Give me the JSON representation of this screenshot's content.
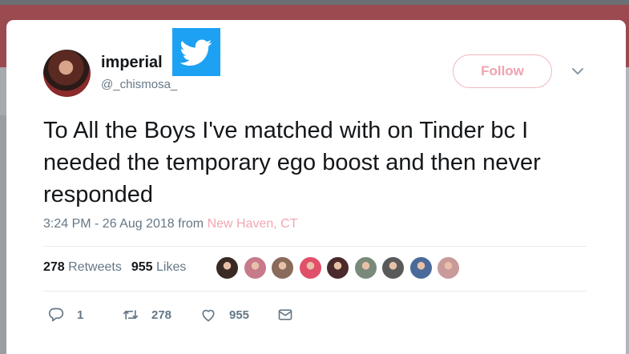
{
  "tweet": {
    "author": {
      "name": "imperial",
      "handle": "@_chismosa_"
    },
    "follow_label": "Follow",
    "text": "To All the Boys I've matched with on Tinder bc I needed the temporary ego boost and then never responded",
    "timestamp": "3:24 PM - 26 Aug 2018 from ",
    "location": "New Haven, CT",
    "stats": {
      "retweets_count": "278",
      "retweets_label": "Retweets",
      "likes_count": "955",
      "likes_label": "Likes"
    },
    "likers": [
      {
        "color": "#3a2a24"
      },
      {
        "color": "#c77a8a"
      },
      {
        "color": "#8a6a5a"
      },
      {
        "color": "#e0506a"
      },
      {
        "color": "#4a2a2a"
      },
      {
        "color": "#7a8a7a"
      },
      {
        "color": "#5a5a5a"
      },
      {
        "color": "#4a6a9a"
      },
      {
        "color": "#c89a9a"
      }
    ],
    "actions": {
      "reply_count": "1",
      "retweet_count": "278",
      "like_count": "955"
    }
  },
  "icons": [
    "twitter-logo-icon",
    "chevron-down-icon",
    "reply-icon",
    "retweet-icon",
    "heart-icon",
    "message-icon"
  ],
  "colors": {
    "accent_pink": "#f3a6b1",
    "text_dark": "#14171a",
    "text_muted": "#657786",
    "twitter_blue": "#1da1f2"
  }
}
